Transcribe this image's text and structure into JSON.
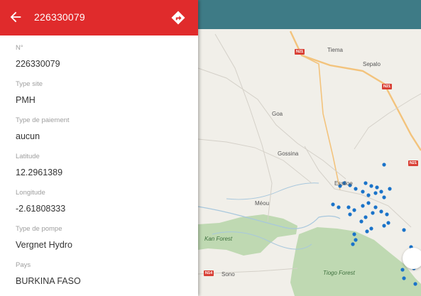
{
  "header": {
    "title": "226330079",
    "back_icon": "arrow-left-icon",
    "directions_icon": "directions-icon",
    "color": "#e02b2c"
  },
  "details": [
    {
      "label": "N°",
      "value": "226330079"
    },
    {
      "label": "Type site",
      "value": "PMH"
    },
    {
      "label": "Type de paiement",
      "value": "aucun"
    },
    {
      "label": "Latitude",
      "value": "12.2961389"
    },
    {
      "label": "Longitude",
      "value": "-2.61808333"
    },
    {
      "label": "Type de pompe",
      "value": "Vergnet Hydro"
    },
    {
      "label": "Pays",
      "value": "BURKINA FASO"
    }
  ],
  "map": {
    "toolbar_color": "#3e7b86",
    "places": [
      "Tiema",
      "Sepalo",
      "Goa",
      "Gossina",
      "Méou",
      "Essiloe",
      "Sono"
    ],
    "road_shields": [
      "N21",
      "N21",
      "N21",
      "N14"
    ],
    "forests": [
      "Kan Forest",
      "Tiogo Forest"
    ],
    "marker_color": "#1a73c9"
  }
}
